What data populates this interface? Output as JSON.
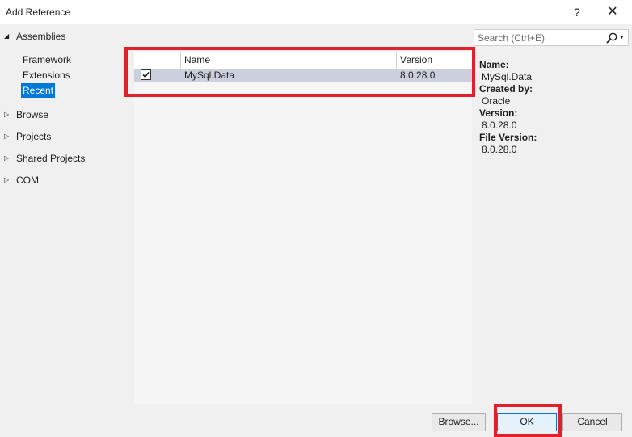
{
  "window": {
    "title": "Add Reference",
    "help_label": "?",
    "close_label": "✕"
  },
  "nav": {
    "assemblies_label": "Assemblies",
    "assemblies_children": [
      "Framework",
      "Extensions",
      "Recent"
    ],
    "selected": "Recent",
    "sections": [
      "Browse",
      "Projects",
      "Shared Projects",
      "COM"
    ]
  },
  "list": {
    "headers": {
      "name": "Name",
      "version": "Version"
    },
    "rows": [
      {
        "checked": true,
        "name": "MySql.Data",
        "version": "8.0.28.0"
      }
    ]
  },
  "search": {
    "placeholder": "Search (Ctrl+E)"
  },
  "details": {
    "name_label": "Name:",
    "name_value": "MySql.Data",
    "created_by_label": "Created by:",
    "created_by_value": "Oracle",
    "version_label": "Version:",
    "version_value": "8.0.28.0",
    "file_version_label": "File Version:",
    "file_version_value": "8.0.28.0"
  },
  "buttons": {
    "browse": "Browse...",
    "ok": "OK",
    "cancel": "Cancel"
  },
  "colors": {
    "annotation": "#e0202a",
    "selection": "#0078d7",
    "row_highlight": "#cbd0dc"
  }
}
